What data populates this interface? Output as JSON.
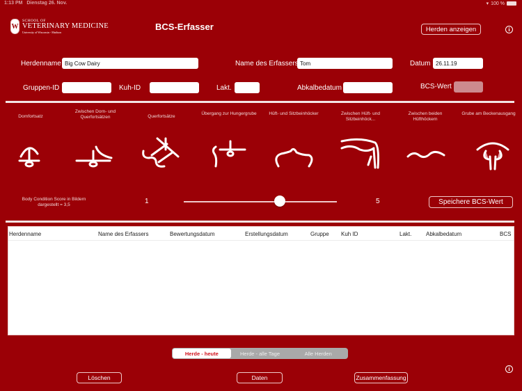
{
  "status_bar": {
    "time": "1:13 PM",
    "date": "Dienstag 26. Nov.",
    "wifi": "wifi-icon",
    "battery_text": "100 %"
  },
  "logo": {
    "crest_letter": "W",
    "line1": "SCHOOL OF",
    "line2": "VETERINARY MEDICINE",
    "line3": "University of Wisconsin - Madison"
  },
  "header": {
    "title": "BCS-Erfasser",
    "show_herds_label": "Herden anzeigen",
    "info_glyph": "i"
  },
  "form": {
    "herd_name": {
      "label": "Herdenname",
      "value": "Big Cow Dairy"
    },
    "recorder_name": {
      "label": "Name des Erfassers",
      "value": "Tom"
    },
    "date": {
      "label": "Datum",
      "value": "26.11.19"
    },
    "group_id": {
      "label": "Gruppen-ID",
      "value": ""
    },
    "cow_id": {
      "label": "Kuh-ID",
      "value": ""
    },
    "lactation": {
      "label": "Lakt.",
      "value": ""
    },
    "calving_date": {
      "label": "Abkalbedatum",
      "value": ""
    },
    "bcs_value": {
      "label": "BCS-Wert",
      "value": ""
    }
  },
  "body_parts": [
    {
      "label": "Dornfortsatz"
    },
    {
      "label": "Zwischen Dorn- und Querfortsätzen"
    },
    {
      "label": "Querfortsätze"
    },
    {
      "label": "Übergang zur Hungergrube"
    },
    {
      "label": "Hüft- und Sitzbeinhöcker"
    },
    {
      "label": "Zwischen Hüft- und Sitzbeinhöck..."
    },
    {
      "label": "Zwischen beiden Hüfthöckern"
    },
    {
      "label": "Grube am Beckenausgang"
    }
  ],
  "bcs": {
    "caption_line1": "Body Condition Score in Bildern",
    "caption_line2": "dargestellt = 3,5",
    "slider_min_label": "1",
    "slider_max_label": "5",
    "slider_min": 1,
    "slider_max": 5,
    "slider_value": 3.5,
    "save_label": "Speichere BCS-Wert"
  },
  "table": {
    "columns": [
      "Herdenname",
      "Name des Erfassers",
      "Bewertungsdatum",
      "Erstellungsdatum",
      "Gruppe",
      "Kuh ID",
      "Lakt.",
      "Abkalbedatum",
      "BCS"
    ],
    "rows": []
  },
  "filter": {
    "segments": [
      "Herde - heute",
      "Herde - alle Tage",
      "Alle Herden"
    ],
    "selected": 0
  },
  "footer": {
    "delete_label": "Löschen",
    "data_label": "Daten",
    "summary_label": "Zusammenfassung",
    "info_glyph": "i"
  },
  "colors": {
    "background": "#9b0006",
    "accent_text": "#d0101a",
    "segment_bg": "#a9a9a9"
  }
}
